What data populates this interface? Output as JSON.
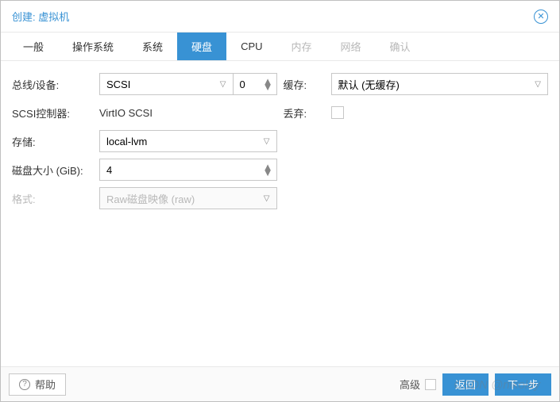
{
  "title": "创建: 虚拟机",
  "tabs": [
    {
      "label": "一般",
      "state": "normal"
    },
    {
      "label": "操作系统",
      "state": "normal"
    },
    {
      "label": "系统",
      "state": "normal"
    },
    {
      "label": "硬盘",
      "state": "active"
    },
    {
      "label": "CPU",
      "state": "normal"
    },
    {
      "label": "内存",
      "state": "disabled"
    },
    {
      "label": "网络",
      "state": "disabled"
    },
    {
      "label": "确认",
      "state": "disabled"
    }
  ],
  "left": {
    "bus_label": "总线/设备:",
    "bus_value": "SCSI",
    "bus_num": "0",
    "scsi_label": "SCSI控制器:",
    "scsi_value": "VirtIO SCSI",
    "storage_label": "存储:",
    "storage_value": "local-lvm",
    "disksize_label": "磁盘大小 (GiB):",
    "disksize_value": "4",
    "format_label": "格式:",
    "format_value": "Raw磁盘映像 (raw)"
  },
  "right": {
    "cache_label": "缓存:",
    "cache_value": "默认 (无缓存)",
    "discard_label": "丢弃:"
  },
  "footer": {
    "help": "帮助",
    "advanced": "高级",
    "back": "返回",
    "next": "下一步"
  },
  "watermark": "CSDN @nikolay"
}
